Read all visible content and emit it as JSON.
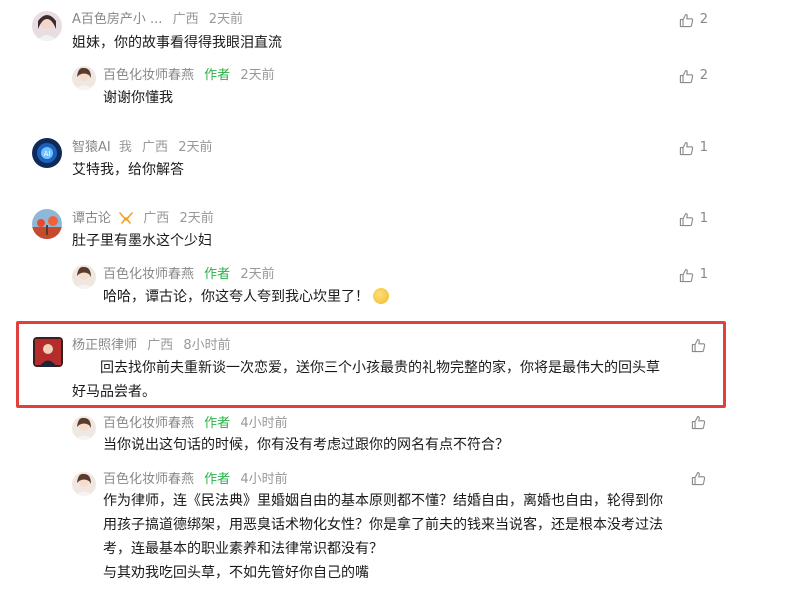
{
  "comments": [
    {
      "name": "A百色房产小 ...",
      "location": "广西",
      "time": "2天前",
      "text": "姐妹，你的故事看得得我眼泪直流",
      "likes": "2",
      "avatar": "girl-portrait-avatar",
      "reply": {
        "name": "百色化妆师春燕",
        "tag": "作者",
        "time": "2天前",
        "text": "谢谢你懂我",
        "likes": "2",
        "avatar": "author-avatar"
      }
    },
    {
      "name": "智猿AI",
      "extra": "我",
      "location": "广西",
      "time": "2天前",
      "text": "艾特我，给你解答",
      "likes": "1",
      "avatar": "ai-robot-avatar"
    },
    {
      "name": "谭古论",
      "location": "广西",
      "time": "2天前",
      "text": "肚子里有墨水这个少妇",
      "likes": "1",
      "avatar": "landscape-avatar",
      "badge_icon": "ribbon-icon",
      "reply": {
        "name": "百色化妆师春燕",
        "tag": "作者",
        "time": "2天前",
        "text": "哈哈，谭古论，你这夸人夸到我心坎里了！",
        "emoji": "thinking-face-emoji",
        "likes": "1",
        "avatar": "author-avatar"
      }
    },
    {
      "name": "杨正照律师",
      "location": "广西",
      "time": "8小时前",
      "text_line1": "回去找你前夫重新谈一次恋爱，送你三个小孩最贵的礼物完整的家，你将是最伟大的回头草",
      "text_line2": "好马品尝者。",
      "likes": "",
      "avatar": "lawyer-avatar",
      "highlight_color": "#e0413d",
      "replies": [
        {
          "name": "百色化妆师春燕",
          "tag": "作者",
          "time": "4小时前",
          "text": "当你说出这句话的时候，你有没有考虑过跟你的网名有点不符合？",
          "likes": "",
          "avatar": "author-avatar"
        },
        {
          "name": "百色化妆师春燕",
          "tag": "作者",
          "time": "4小时前",
          "lines": [
            "作为律师，连《民法典》里婚姻自由的基本原则都不懂？结婚自由，离婚也自由，轮得到你",
            "用孩子搞道德绑架，用恶臭话术物化女性？你是拿了前夫的钱来当说客，还是根本没考过法",
            "考，连最基本的职业素养和法律常识都没有？",
            "与其劝我吃回头草，不如先管好你自己的嘴"
          ],
          "likes": "",
          "avatar": "author-avatar"
        }
      ]
    }
  ],
  "colors": {
    "author_tag": "#2bb14a",
    "meta": "#999999",
    "text": "#1a1a1a"
  }
}
